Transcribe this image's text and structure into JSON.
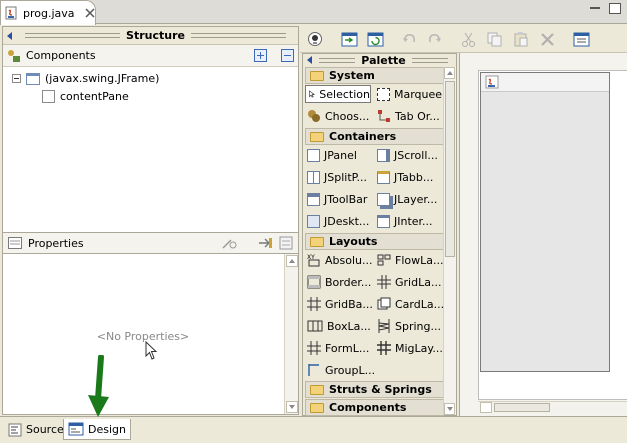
{
  "editor": {
    "tab_label": "prog.java",
    "icons": [
      "java-file-icon",
      "close-icon",
      "minimize-icon",
      "maximize-icon"
    ]
  },
  "structure": {
    "title": "Structure",
    "components_label": "Components",
    "tree": [
      {
        "label": "(javax.swing.JFrame)",
        "icon": "jframe-icon"
      },
      {
        "label": "contentPane",
        "icon": "panel-icon"
      }
    ]
  },
  "properties": {
    "title": "Properties",
    "empty_text": "<No Properties>"
  },
  "palette": {
    "title": "Palette",
    "categories": {
      "system": "System",
      "containers": "Containers",
      "layouts": "Layouts",
      "struts": "Struts & Springs",
      "components": "Components"
    },
    "system_items": [
      "Selection",
      "Marquee",
      "Choos...",
      "Tab Or..."
    ],
    "container_items": [
      "JPanel",
      "JScroll...",
      "JSplitP...",
      "JTabb...",
      "JToolBar",
      "JLayer...",
      "JDeskt...",
      "JInter..."
    ],
    "layout_items": [
      "Absolu...",
      "FlowLa...",
      "Border...",
      "GridLa...",
      "GridBa...",
      "CardLa...",
      "BoxLa...",
      "Spring...",
      "FormL...",
      "MigLay...",
      "GroupL..."
    ]
  },
  "bottom_tabs": {
    "source": "Source",
    "design": "Design",
    "active": "Design"
  },
  "colors": {
    "accent": "#3d6ab7",
    "folder": "#f4d27a",
    "annotation_arrow": "#1a7a1a"
  }
}
